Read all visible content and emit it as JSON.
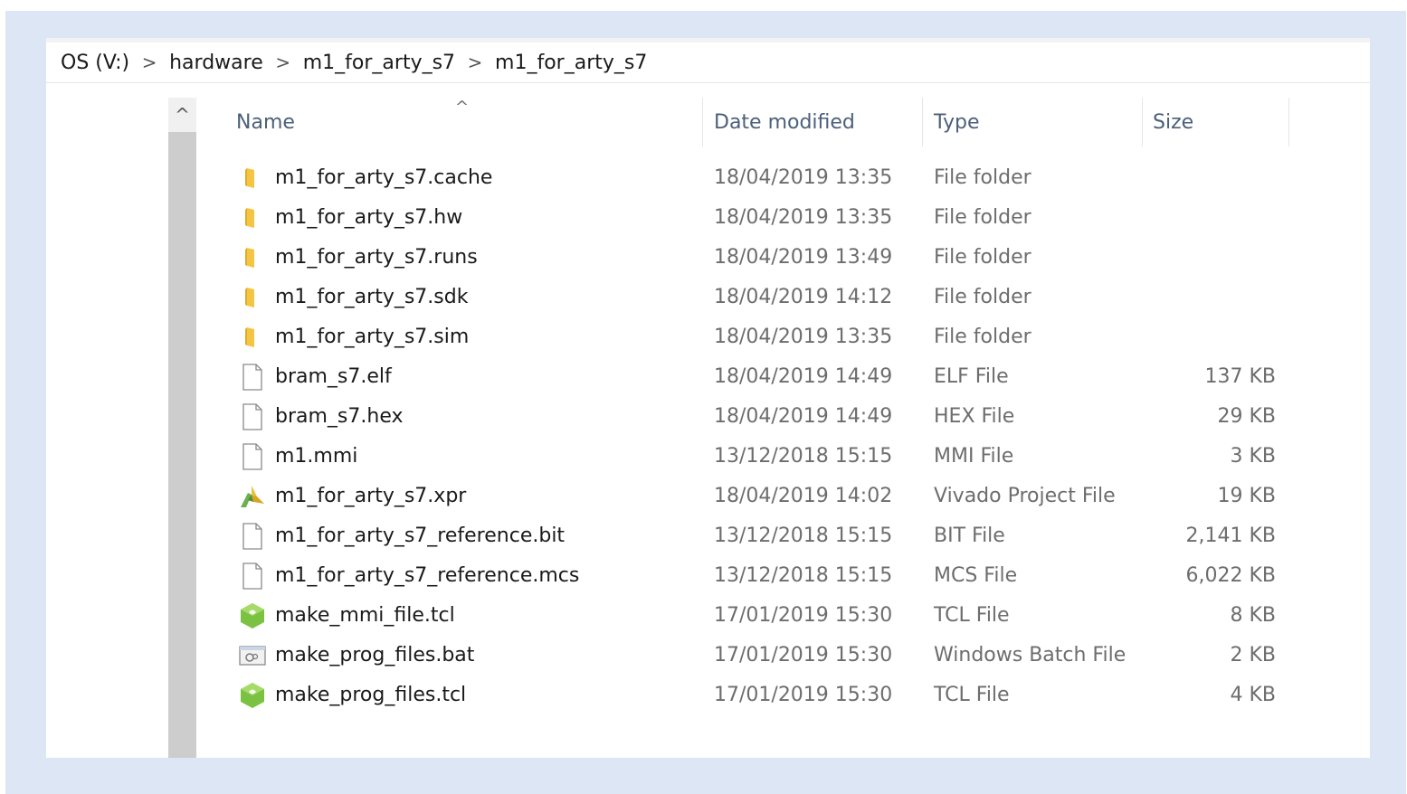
{
  "breadcrumb": {
    "items": [
      {
        "label": "OS (V:)"
      },
      {
        "label": "hardware"
      },
      {
        "label": "m1_for_arty_s7"
      },
      {
        "label": "m1_for_arty_s7"
      }
    ],
    "separator": ">"
  },
  "columns": {
    "name": "Name",
    "date": "Date modified",
    "type": "Type",
    "size": "Size"
  },
  "sort_indicator": "^",
  "scroll_up": "^",
  "files": [
    {
      "icon": "folder-icon",
      "name": "m1_for_arty_s7.cache",
      "date": "18/04/2019 13:35",
      "type": "File folder",
      "size": ""
    },
    {
      "icon": "folder-icon",
      "name": "m1_for_arty_s7.hw",
      "date": "18/04/2019 13:35",
      "type": "File folder",
      "size": ""
    },
    {
      "icon": "folder-icon",
      "name": "m1_for_arty_s7.runs",
      "date": "18/04/2019 13:49",
      "type": "File folder",
      "size": ""
    },
    {
      "icon": "folder-icon",
      "name": "m1_for_arty_s7.sdk",
      "date": "18/04/2019 14:12",
      "type": "File folder",
      "size": ""
    },
    {
      "icon": "folder-icon",
      "name": "m1_for_arty_s7.sim",
      "date": "18/04/2019 13:35",
      "type": "File folder",
      "size": ""
    },
    {
      "icon": "file-icon",
      "name": "bram_s7.elf",
      "date": "18/04/2019 14:49",
      "type": "ELF File",
      "size": "137 KB"
    },
    {
      "icon": "file-icon",
      "name": "bram_s7.hex",
      "date": "18/04/2019 14:49",
      "type": "HEX File",
      "size": "29 KB"
    },
    {
      "icon": "file-icon",
      "name": "m1.mmi",
      "date": "13/12/2018 15:15",
      "type": "MMI File",
      "size": "3 KB"
    },
    {
      "icon": "vivado-icon",
      "name": "m1_for_arty_s7.xpr",
      "date": "18/04/2019 14:02",
      "type": "Vivado Project File",
      "size": "19 KB"
    },
    {
      "icon": "file-icon",
      "name": "m1_for_arty_s7_reference.bit",
      "date": "13/12/2018 15:15",
      "type": "BIT File",
      "size": "2,141 KB"
    },
    {
      "icon": "file-icon",
      "name": "m1_for_arty_s7_reference.mcs",
      "date": "13/12/2018 15:15",
      "type": "MCS File",
      "size": "6,022 KB"
    },
    {
      "icon": "tcl-icon",
      "name": "make_mmi_file.tcl",
      "date": "17/01/2019 15:30",
      "type": "TCL File",
      "size": "8 KB"
    },
    {
      "icon": "batch-icon",
      "name": "make_prog_files.bat",
      "date": "17/01/2019 15:30",
      "type": "Windows Batch File",
      "size": "2 KB"
    },
    {
      "icon": "tcl-icon",
      "name": "make_prog_files.tcl",
      "date": "17/01/2019 15:30",
      "type": "TCL File",
      "size": "4 KB"
    }
  ],
  "colors": {
    "frame": "#dce6f4",
    "header_text": "#4c607a",
    "folder": "#f4c542",
    "tcl_green": "#7cc242",
    "vivado_yellow": "#e8c23a",
    "vivado_green": "#6ab04c"
  }
}
